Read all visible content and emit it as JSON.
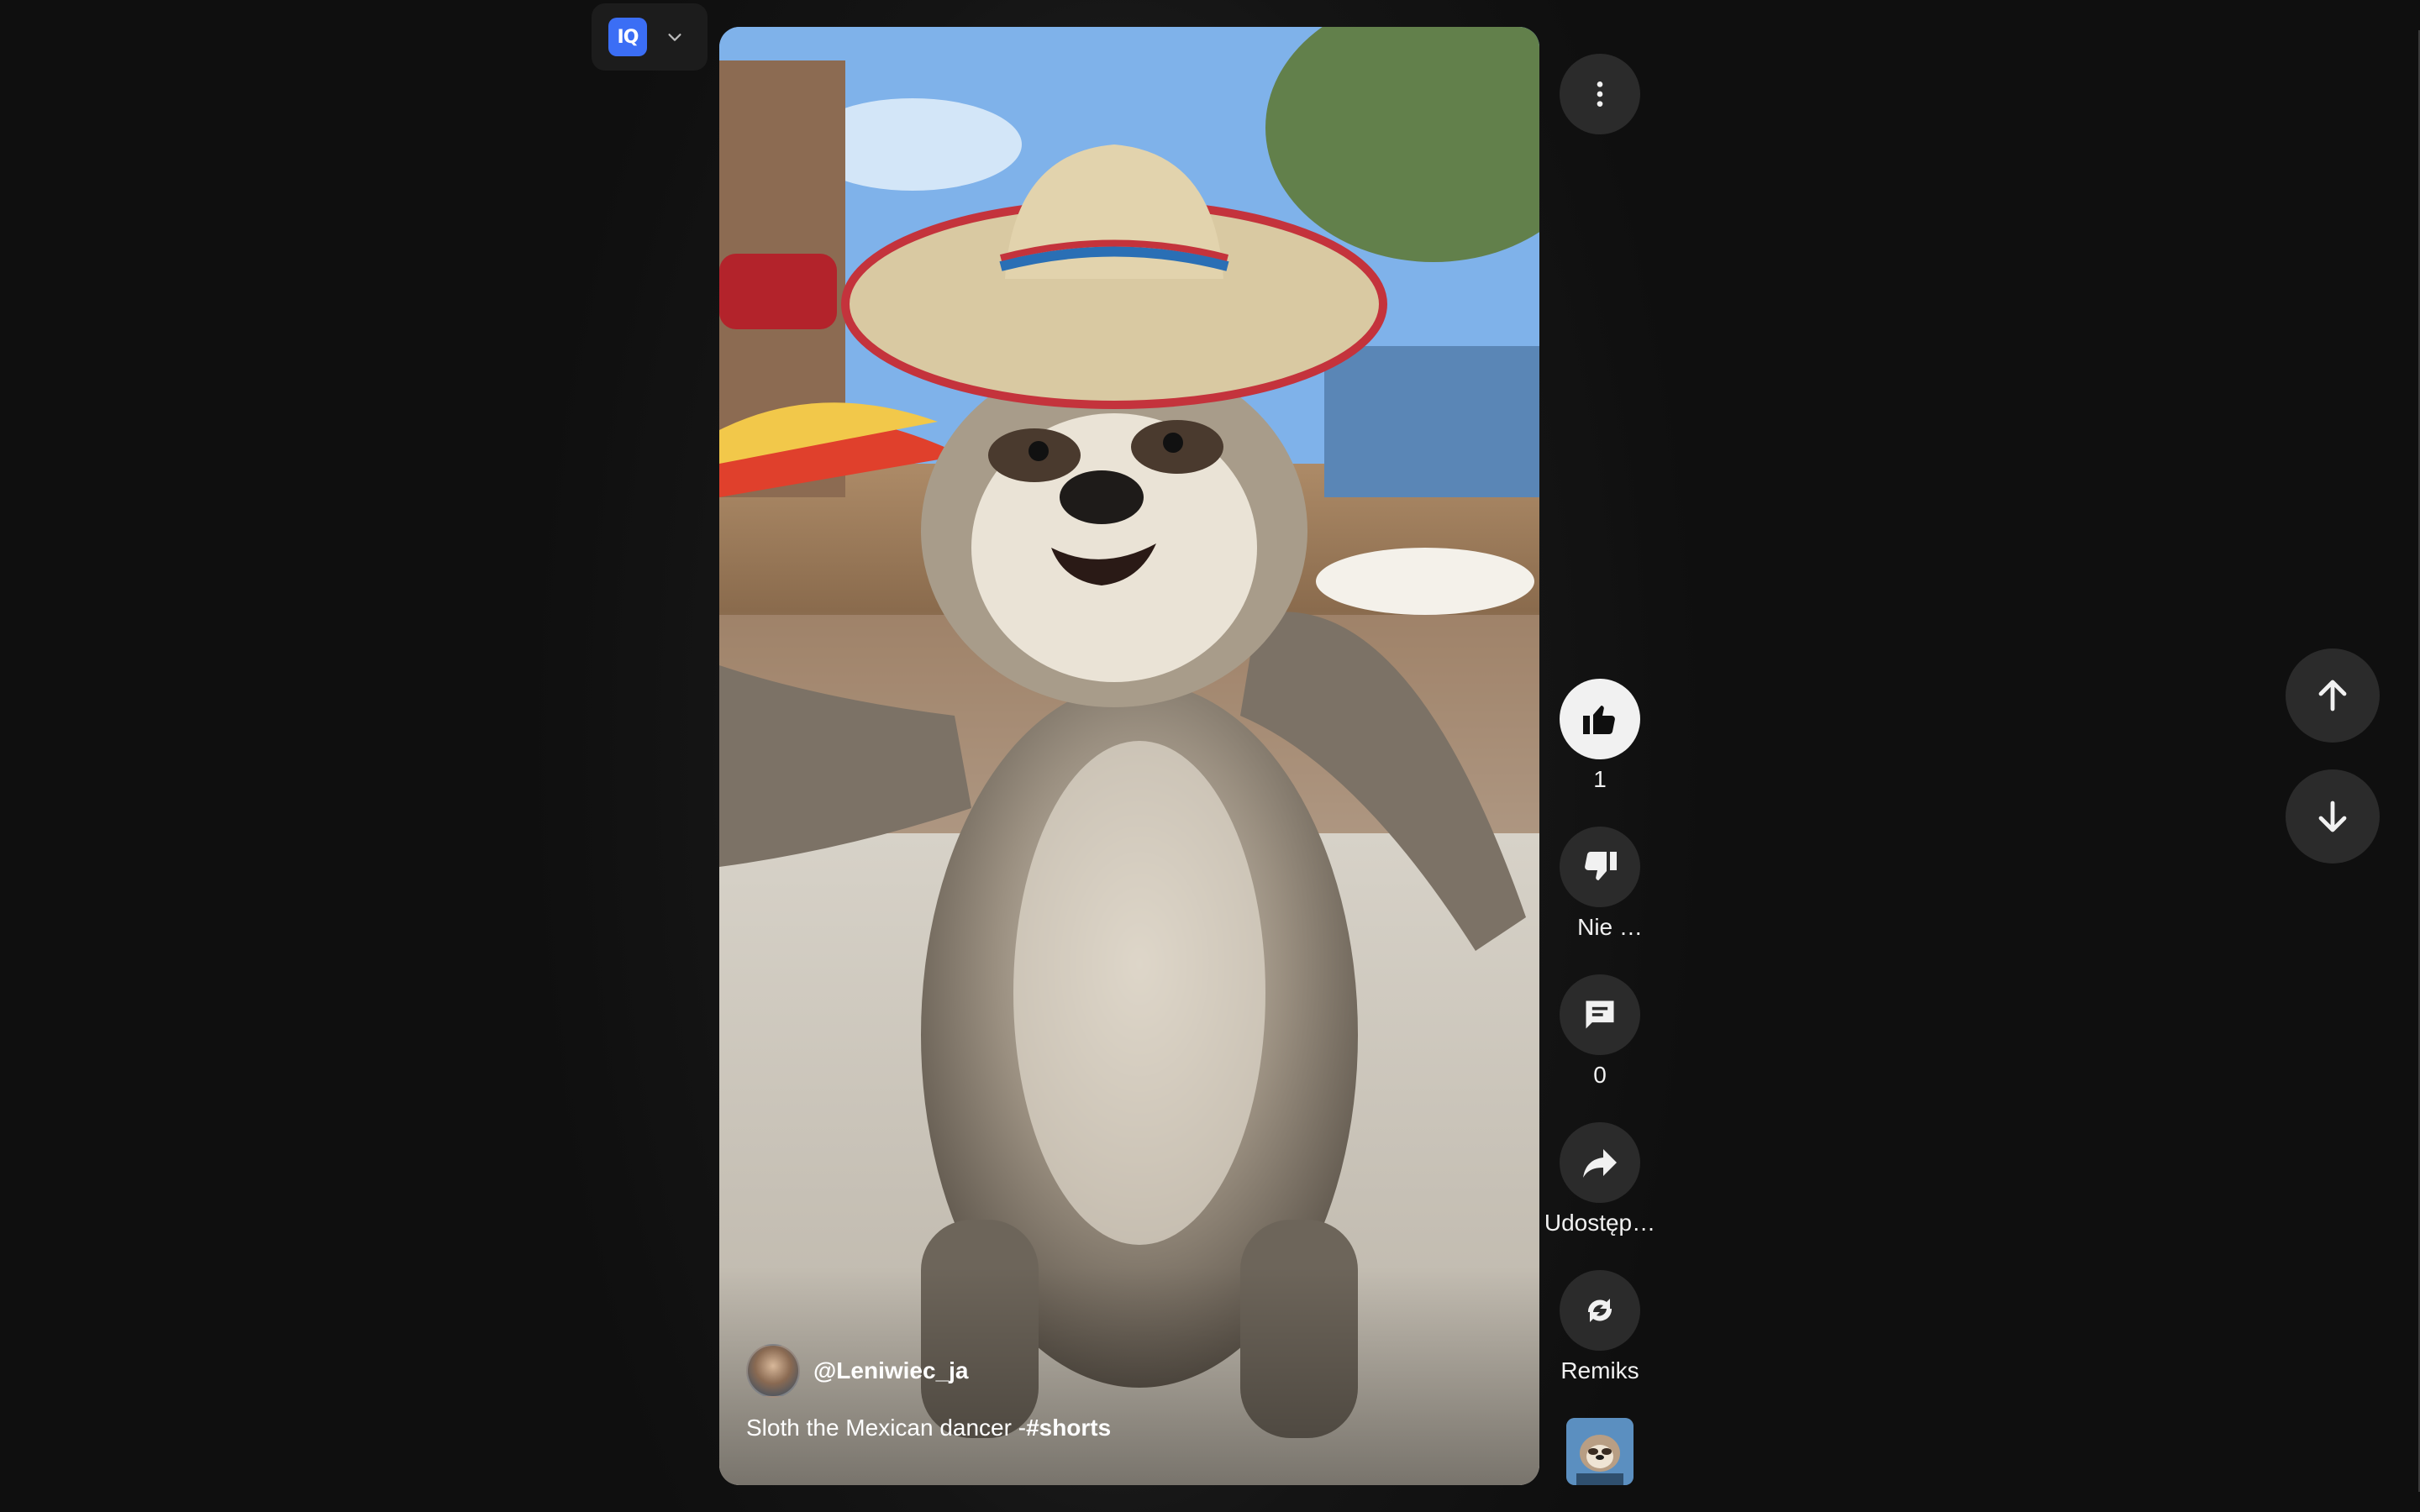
{
  "extension": {
    "logo_text": "IQ",
    "logo_icon": "iq-logo-icon",
    "menu_icon": "chevron-down-icon"
  },
  "video": {
    "channel_handle": "@Leniwiec_ja",
    "caption_text": "Sloth the Mexican dancer -",
    "caption_tag": "#shorts"
  },
  "actions": {
    "more_icon": "more-vertical-icon",
    "like_count": "1",
    "dislike_label": "Nie …",
    "comment_count": "0",
    "share_label": "Udostęp…",
    "remix_label": "Remiks"
  },
  "navigation": {
    "up_icon": "arrow-up-icon",
    "down_icon": "arrow-down-icon"
  },
  "colors": {
    "background": "#0f0f0f",
    "button": "#2b2b2b",
    "like_active": "#f1f1f1",
    "extension_blue": "#3b6ef5"
  }
}
